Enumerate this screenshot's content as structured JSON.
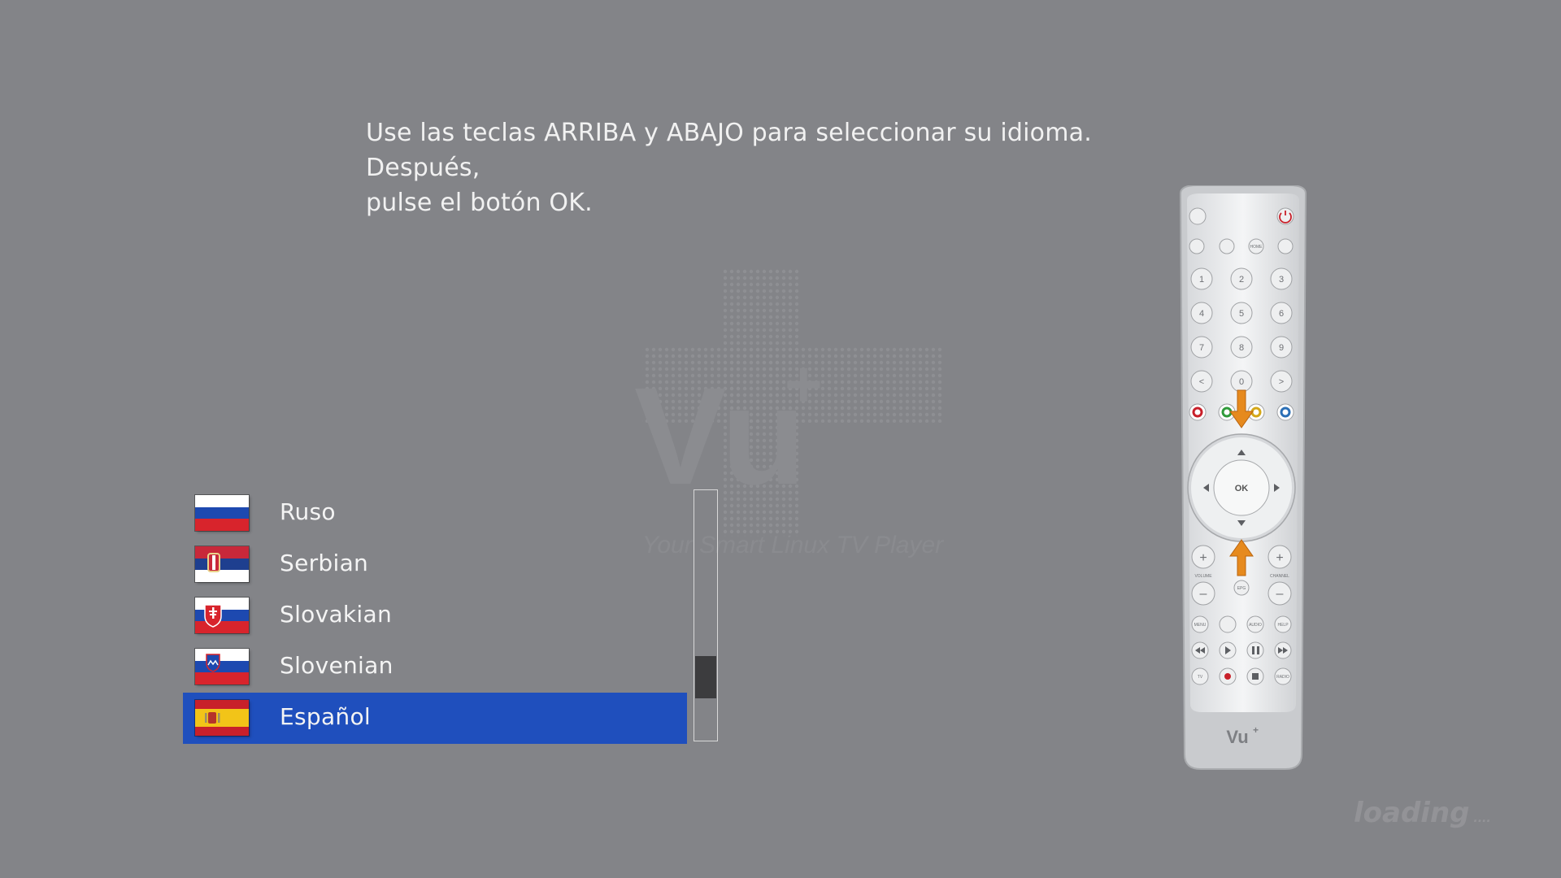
{
  "instruction": {
    "line1": "Use las teclas ARRIBA y ABAJO para seleccionar su idioma. Después,",
    "line2": "pulse el botón OK."
  },
  "watermark": {
    "logo_text": "Vu",
    "tagline": "Your Smart Linux TV Player"
  },
  "languages": [
    {
      "label": "Ruso",
      "flag": "russia-flag-icon",
      "selected": false
    },
    {
      "label": "Serbian",
      "flag": "serbia-flag-icon",
      "selected": false
    },
    {
      "label": "Slovakian",
      "flag": "slovakia-flag-icon",
      "selected": false
    },
    {
      "label": "Slovenian",
      "flag": "slovenia-flag-icon",
      "selected": false
    },
    {
      "label": "Español",
      "flag": "spain-flag-icon",
      "selected": true
    }
  ],
  "scrollbar": {
    "position_fraction": 0.75
  },
  "remote": {
    "brand": "Vu",
    "number_keys": [
      "1",
      "2",
      "3",
      "4",
      "5",
      "6",
      "7",
      "8",
      "9",
      "0"
    ],
    "ok_label": "OK",
    "volume_label": "VOLUME",
    "channel_label": "CHANNEL",
    "epg_label": "EPG",
    "home_label": "HOME",
    "menu_label": "MENU",
    "audio_label": "AUDIO",
    "help_label": "HELP",
    "tv_label": "TV",
    "radio_label": "RADIO",
    "color_keys": [
      "#c8202a",
      "#2f9a3a",
      "#d4a718",
      "#2b6fb6"
    ],
    "arrow_color": "#e68a1e"
  },
  "loading_text": "loading"
}
